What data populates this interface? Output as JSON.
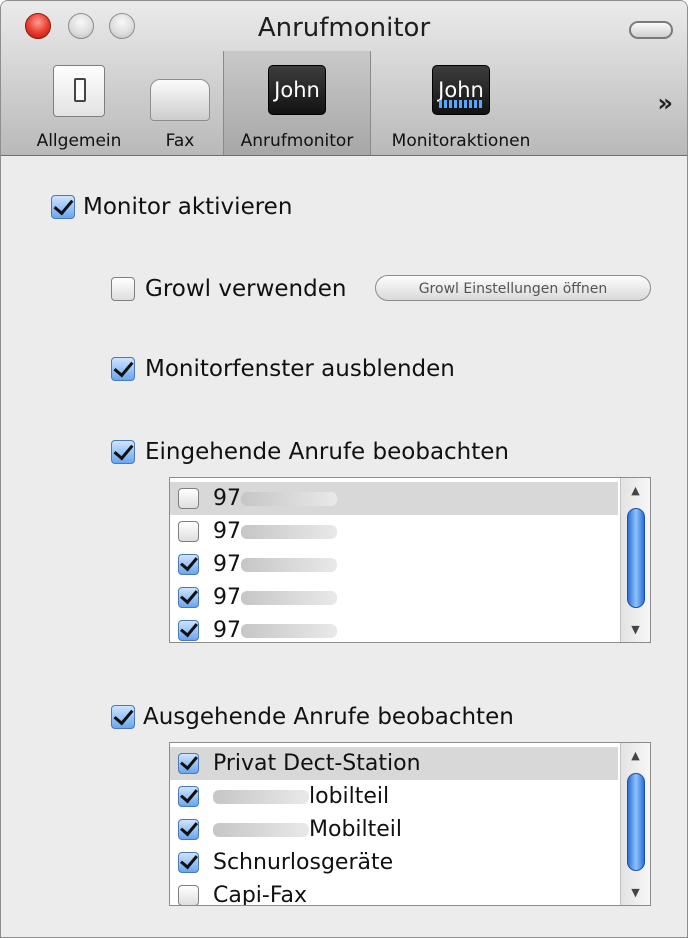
{
  "window": {
    "title": "Anrufmonitor"
  },
  "toolbar": {
    "items": [
      {
        "label": "Allgemein",
        "icon": "switch-icon"
      },
      {
        "label": "Fax",
        "icon": "fax-icon"
      },
      {
        "label": "Anrufmonitor",
        "icon": "john-icon",
        "badge": "John"
      },
      {
        "label": "Monitoraktionen",
        "icon": "john-wave-icon",
        "badge": "John"
      }
    ],
    "overflow": "»"
  },
  "content": {
    "monitor_aktivieren": {
      "label": "Monitor aktivieren",
      "checked": true
    },
    "growl": {
      "label": "Growl verwenden",
      "checked": false,
      "button": "Growl Einstellungen öffnen"
    },
    "monitorfenster": {
      "label": "Monitorfenster ausblenden",
      "checked": true
    },
    "eingehend": {
      "label": "Eingehende Anrufe beobachten",
      "checked": true,
      "items": [
        {
          "text": "97",
          "checked": false
        },
        {
          "text": "97",
          "checked": false
        },
        {
          "text": "97",
          "checked": true
        },
        {
          "text": "97",
          "checked": true
        },
        {
          "text": "97",
          "checked": true
        }
      ]
    },
    "ausgehend": {
      "label": "Ausgehende Anrufe beobachten",
      "checked": true,
      "items": [
        {
          "text": "Privat Dect-Station",
          "checked": true
        },
        {
          "text": "lobilteil",
          "checked": true
        },
        {
          "text": "Mobilteil",
          "checked": true
        },
        {
          "text": "Schnurlosgeräte",
          "checked": true
        },
        {
          "text": "Capi-Fax",
          "checked": false
        }
      ]
    }
  },
  "colors": {
    "accent": "#4a89e8",
    "selected_row": "#d8d8d8"
  }
}
